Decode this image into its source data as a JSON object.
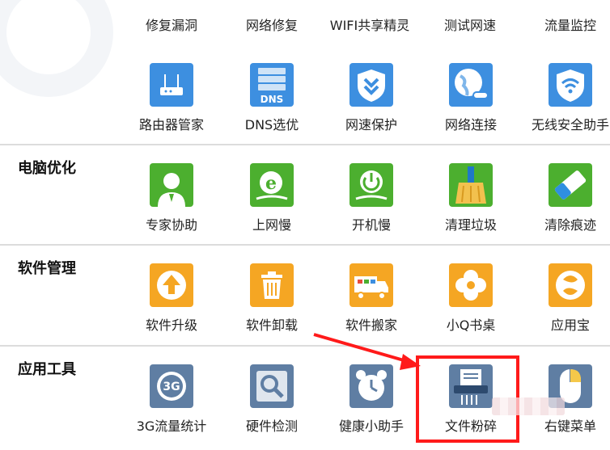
{
  "top_row": {
    "items": [
      {
        "label": "修复漏洞"
      },
      {
        "label": "网络修复"
      },
      {
        "label": "WIFI共享精灵"
      },
      {
        "label": "测试网速"
      },
      {
        "label": "流量监控"
      }
    ]
  },
  "network_row": {
    "items": [
      {
        "label": "路由器管家",
        "icon": "router-icon"
      },
      {
        "label": "DNS选优",
        "icon": "dns-server-icon",
        "icon_text": "DNS"
      },
      {
        "label": "网速保护",
        "icon": "shield-chevron-icon"
      },
      {
        "label": "网络连接",
        "icon": "globe-link-icon"
      },
      {
        "label": "无线安全助手",
        "icon": "wifi-shield-icon"
      }
    ]
  },
  "sections": [
    {
      "title": "电脑优化",
      "items": [
        {
          "label": "专家协助",
          "icon": "expert-icon"
        },
        {
          "label": "上网慢",
          "icon": "ie-snail-icon"
        },
        {
          "label": "开机慢",
          "icon": "power-snail-icon"
        },
        {
          "label": "清理垃圾",
          "icon": "broom-icon"
        },
        {
          "label": "清除痕迹",
          "icon": "eraser-icon"
        }
      ]
    },
    {
      "title": "软件管理",
      "items": [
        {
          "label": "软件升级",
          "icon": "upgrade-arrow-icon"
        },
        {
          "label": "软件卸载",
          "icon": "trash-icon"
        },
        {
          "label": "软件搬家",
          "icon": "truck-icon"
        },
        {
          "label": "小Q书桌",
          "icon": "clover-icon"
        },
        {
          "label": "应用宝",
          "icon": "app-store-icon"
        }
      ]
    },
    {
      "title": "应用工具",
      "items": [
        {
          "label": "3G流量统计",
          "icon": "3g-icon",
          "icon_text": "3G"
        },
        {
          "label": "硬件检测",
          "icon": "magnifier-chip-icon"
        },
        {
          "label": "健康小助手",
          "icon": "alarm-clock-icon"
        },
        {
          "label": "文件粉碎",
          "icon": "shredder-icon"
        },
        {
          "label": "右键菜单",
          "icon": "mouse-icon"
        }
      ]
    }
  ],
  "colors": {
    "annotation_red": "#ff1a1a",
    "network_blue": "#3d8fe0",
    "optimize_green": "#4caf2f",
    "software_orange": "#f5a623",
    "tools_steel": "#5f7ea3"
  }
}
